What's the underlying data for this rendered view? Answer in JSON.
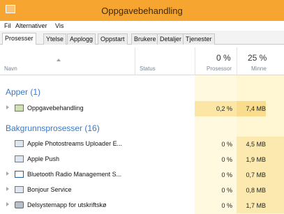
{
  "window": {
    "title": "Oppgavebehandling"
  },
  "menubar": {
    "items": [
      "Fil",
      "Alternativer",
      "Vis"
    ]
  },
  "tabs": [
    "Prosesser",
    "Ytelse",
    "Applogg",
    "Oppstart",
    "Brukere",
    "Detaljer",
    "Tjenester"
  ],
  "columns": {
    "name": "Navn",
    "status": "Status",
    "cpu_pct": "0 %",
    "cpu_label": "Prosessor",
    "mem_pct": "25 %",
    "mem_label": "Minne"
  },
  "groups": [
    {
      "title": "Apper (1)",
      "rows": [
        {
          "name": "Oppgavebehandling",
          "icon": "task-manager-icon",
          "expandable": true,
          "cpu": "0,2 %",
          "mem": "7,4 MB"
        }
      ]
    },
    {
      "title": "Bakgrunnsprosesser (16)",
      "rows": [
        {
          "name": "Apple Photostreams Uploader E...",
          "icon": "app-icon",
          "expandable": false,
          "cpu": "0 %",
          "mem": "4,5 MB"
        },
        {
          "name": "Apple Push",
          "icon": "app-icon",
          "expandable": false,
          "cpu": "0 %",
          "mem": "1,9 MB"
        },
        {
          "name": "Bluetooth Radio Management S...",
          "icon": "monitor-icon",
          "expandable": true,
          "cpu": "0 %",
          "mem": "0,7 MB"
        },
        {
          "name": "Bonjour Service",
          "icon": "app-icon",
          "expandable": true,
          "cpu": "0 %",
          "mem": "0,8 MB"
        },
        {
          "name": "Delsystemapp for utskriftskø",
          "icon": "printer-icon",
          "expandable": true,
          "cpu": "0 %",
          "mem": "1,7 MB"
        }
      ]
    }
  ],
  "colors": {
    "titlebar": "#f7a531",
    "group_title": "#3a78c8",
    "highlight_cpu": "#fbe6a6",
    "highlight_mem": "#f9dd8c"
  }
}
